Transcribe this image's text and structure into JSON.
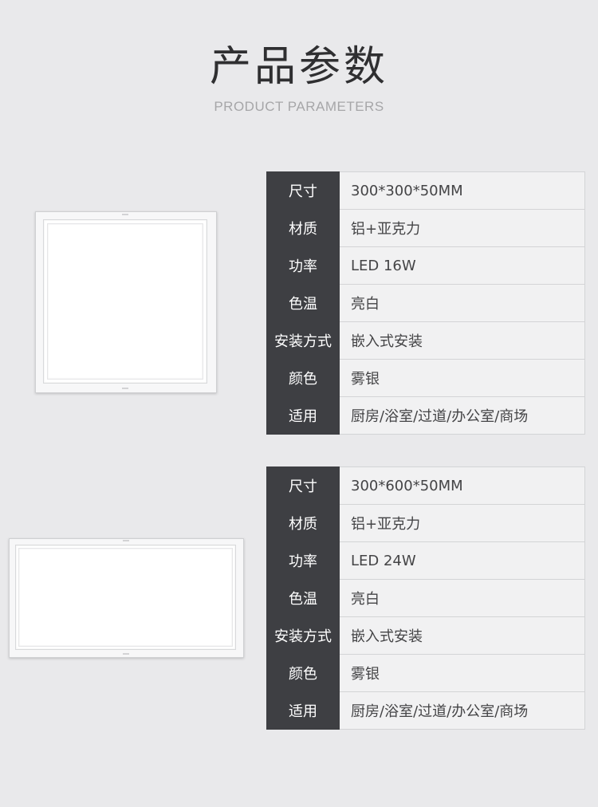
{
  "header": {
    "title": "产品参数",
    "subtitle": "PRODUCT PARAMETERS"
  },
  "products": [
    {
      "image": "square-panel-light",
      "specs": [
        {
          "label": "尺寸",
          "value": "300*300*50MM"
        },
        {
          "label": "材质",
          "value": "铝+亚克力"
        },
        {
          "label": "功率",
          "value": "LED 16W"
        },
        {
          "label": "色温",
          "value": "亮白"
        },
        {
          "label": "安装方式",
          "value": "嵌入式安装"
        },
        {
          "label": "颜色",
          "value": "雾银"
        },
        {
          "label": "适用",
          "value": "厨房/浴室/过道/办公室/商场"
        }
      ]
    },
    {
      "image": "rectangular-panel-light",
      "specs": [
        {
          "label": "尺寸",
          "value": "300*600*50MM"
        },
        {
          "label": "材质",
          "value": "铝+亚克力"
        },
        {
          "label": "功率",
          "value": "LED 24W"
        },
        {
          "label": "色温",
          "value": "亮白"
        },
        {
          "label": "安装方式",
          "value": "嵌入式安装"
        },
        {
          "label": "颜色",
          "value": "雾银"
        },
        {
          "label": "适用",
          "value": "厨房/浴室/过道/办公室/商场"
        }
      ]
    }
  ]
}
